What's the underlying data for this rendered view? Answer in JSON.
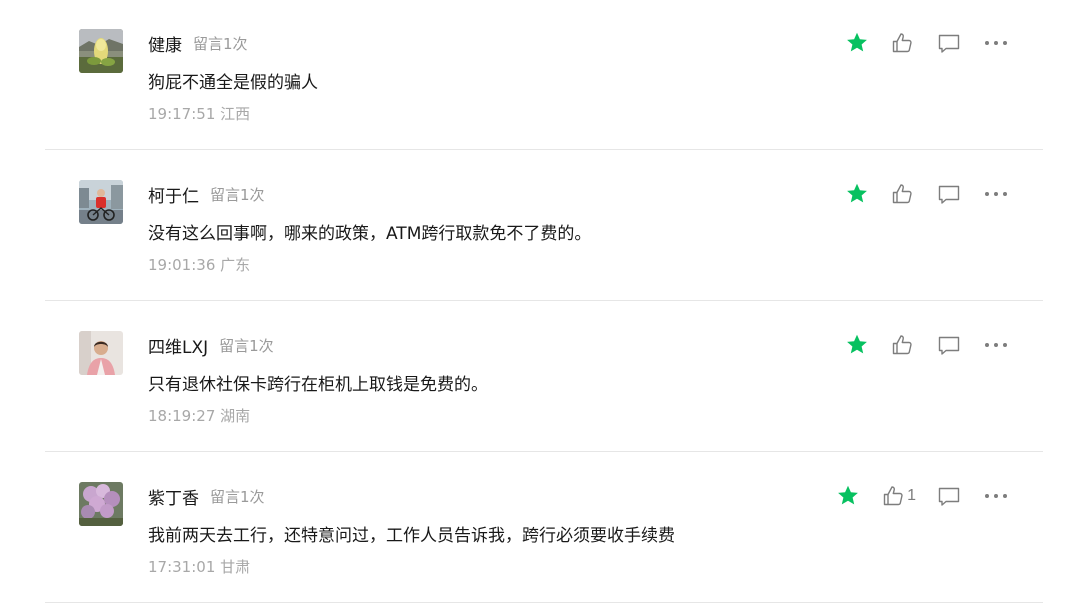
{
  "colors": {
    "star": "#07c160",
    "icon": "#7d7d7d",
    "divider": "#e6e6e6"
  },
  "comments": [
    {
      "name": "健康",
      "count_label": "留言1次",
      "content": "狗屁不通全是假的骗人",
      "time": "19:17:51",
      "location": "江西",
      "like_count": "",
      "avatar_icon": "flower-plant-avatar"
    },
    {
      "name": "柯于仁",
      "count_label": "留言1次",
      "content": "没有这么回事啊，哪来的政策，ATM跨行取款免不了费的。",
      "time": "19:01:36",
      "location": "广东",
      "like_count": "",
      "avatar_icon": "cyclist-avatar"
    },
    {
      "name": "四维LXJ",
      "count_label": "留言1次",
      "content": "只有退休社保卡跨行在柜机上取钱是免费的。",
      "time": "18:19:27",
      "location": "湖南",
      "like_count": "",
      "avatar_icon": "person-portrait-avatar"
    },
    {
      "name": "紫丁香",
      "count_label": "留言1次",
      "content": "我前两天去工行，还特意问过，工作人员告诉我，跨行必须要收手续费",
      "time": "17:31:01",
      "location": "甘肃",
      "like_count": "1",
      "avatar_icon": "lilac-flower-avatar"
    }
  ]
}
